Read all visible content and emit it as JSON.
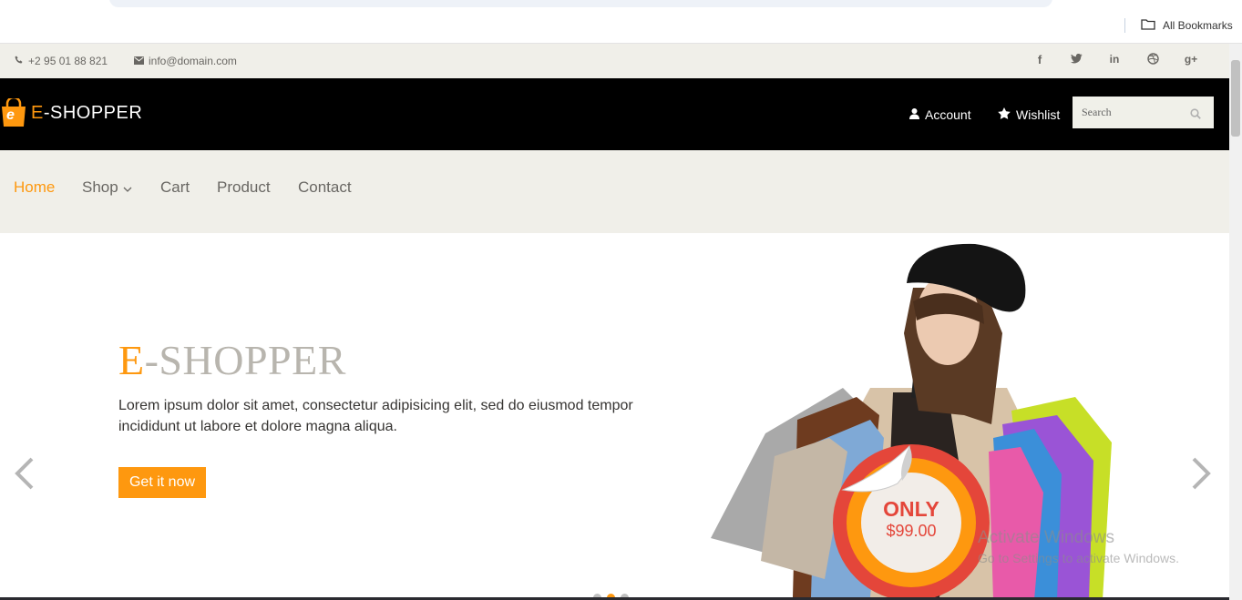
{
  "browser": {
    "bookmarks_label": "All Bookmarks"
  },
  "topbar": {
    "phone": "+2 95 01 88 821",
    "email": "info@domain.com"
  },
  "header": {
    "logo_letter": "e",
    "logo_e": "E",
    "logo_rest": "-SHOPPER",
    "account": "Account",
    "wishlist": "Wishlist",
    "search_placeholder": "Search"
  },
  "nav": {
    "items": [
      {
        "label": "Home"
      },
      {
        "label": "Shop"
      },
      {
        "label": "Cart"
      },
      {
        "label": "Product"
      },
      {
        "label": "Contact"
      }
    ]
  },
  "slider": {
    "title_e": "E",
    "title_rest": "-SHOPPER",
    "text": "Lorem ipsum dolor sit amet, consectetur adipisicing elit, sed do eiusmod tempor incididunt ut labore et dolore magna aliqua.",
    "button": "Get it now",
    "badge_only": "ONLY",
    "badge_price": "$99.00"
  },
  "watermark": {
    "title": "Activate Windows",
    "subtitle": "Go to Settings to activate Windows."
  },
  "colors": {
    "accent": "#fe980f",
    "header_bg": "#000000",
    "light_bg": "#f0efe9",
    "badge_red": "#e4463a"
  }
}
